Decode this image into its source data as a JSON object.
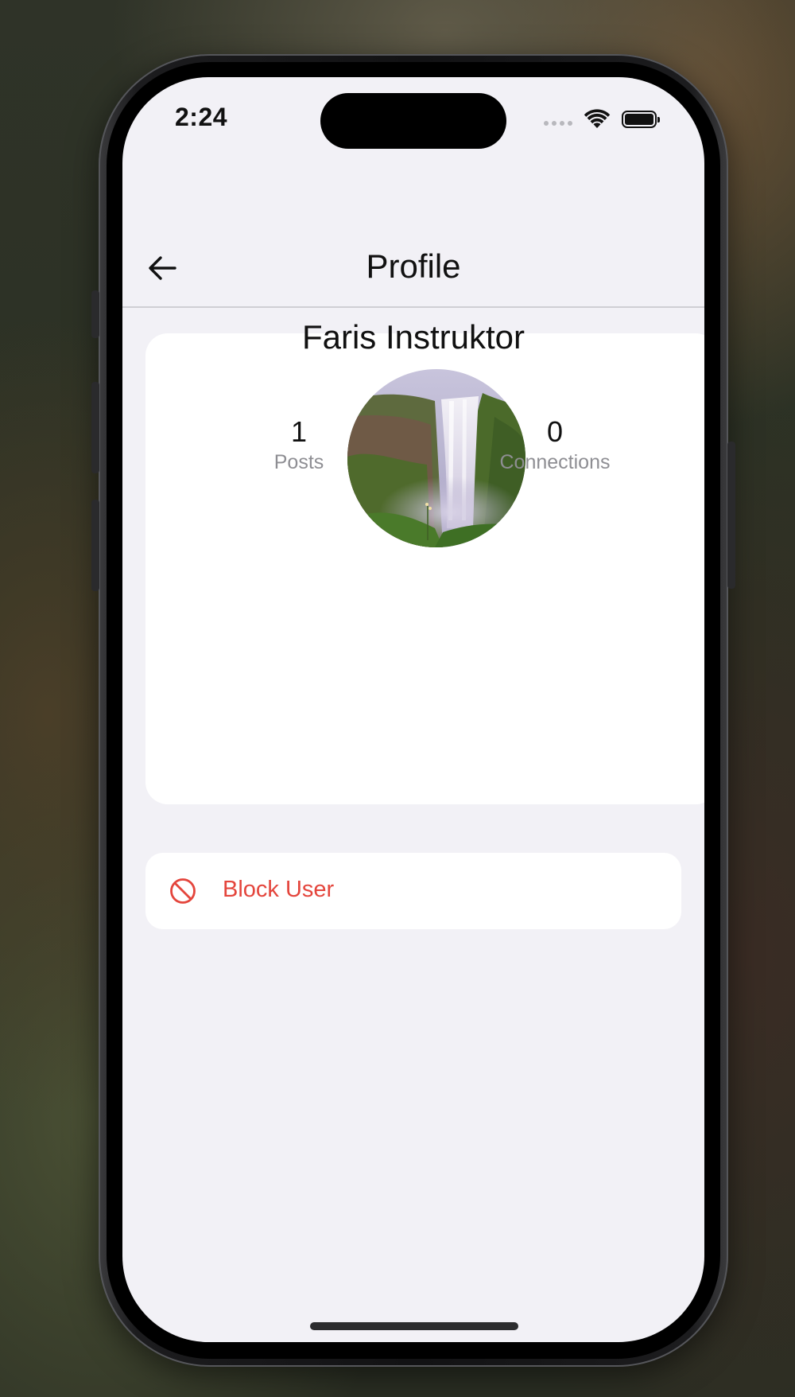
{
  "status_bar": {
    "time": "2:24",
    "icons": [
      "cellular-signal-icon",
      "wifi-icon",
      "battery-icon"
    ]
  },
  "header": {
    "title": "Profile",
    "back_icon": "arrow-left-icon"
  },
  "profile": {
    "avatar_description": "waterfall-photo",
    "name": "Faris Instruktor",
    "stats": [
      {
        "value": "1",
        "label": "Posts"
      },
      {
        "value": "0",
        "label": "Connections"
      }
    ]
  },
  "actions": {
    "block_label": "Block User",
    "block_icon": "prohibited-icon"
  },
  "colors": {
    "screen_background": "#f2f1f6",
    "card_background": "#ffffff",
    "destructive": "#e4453c",
    "secondary_text": "#8e8e93"
  }
}
